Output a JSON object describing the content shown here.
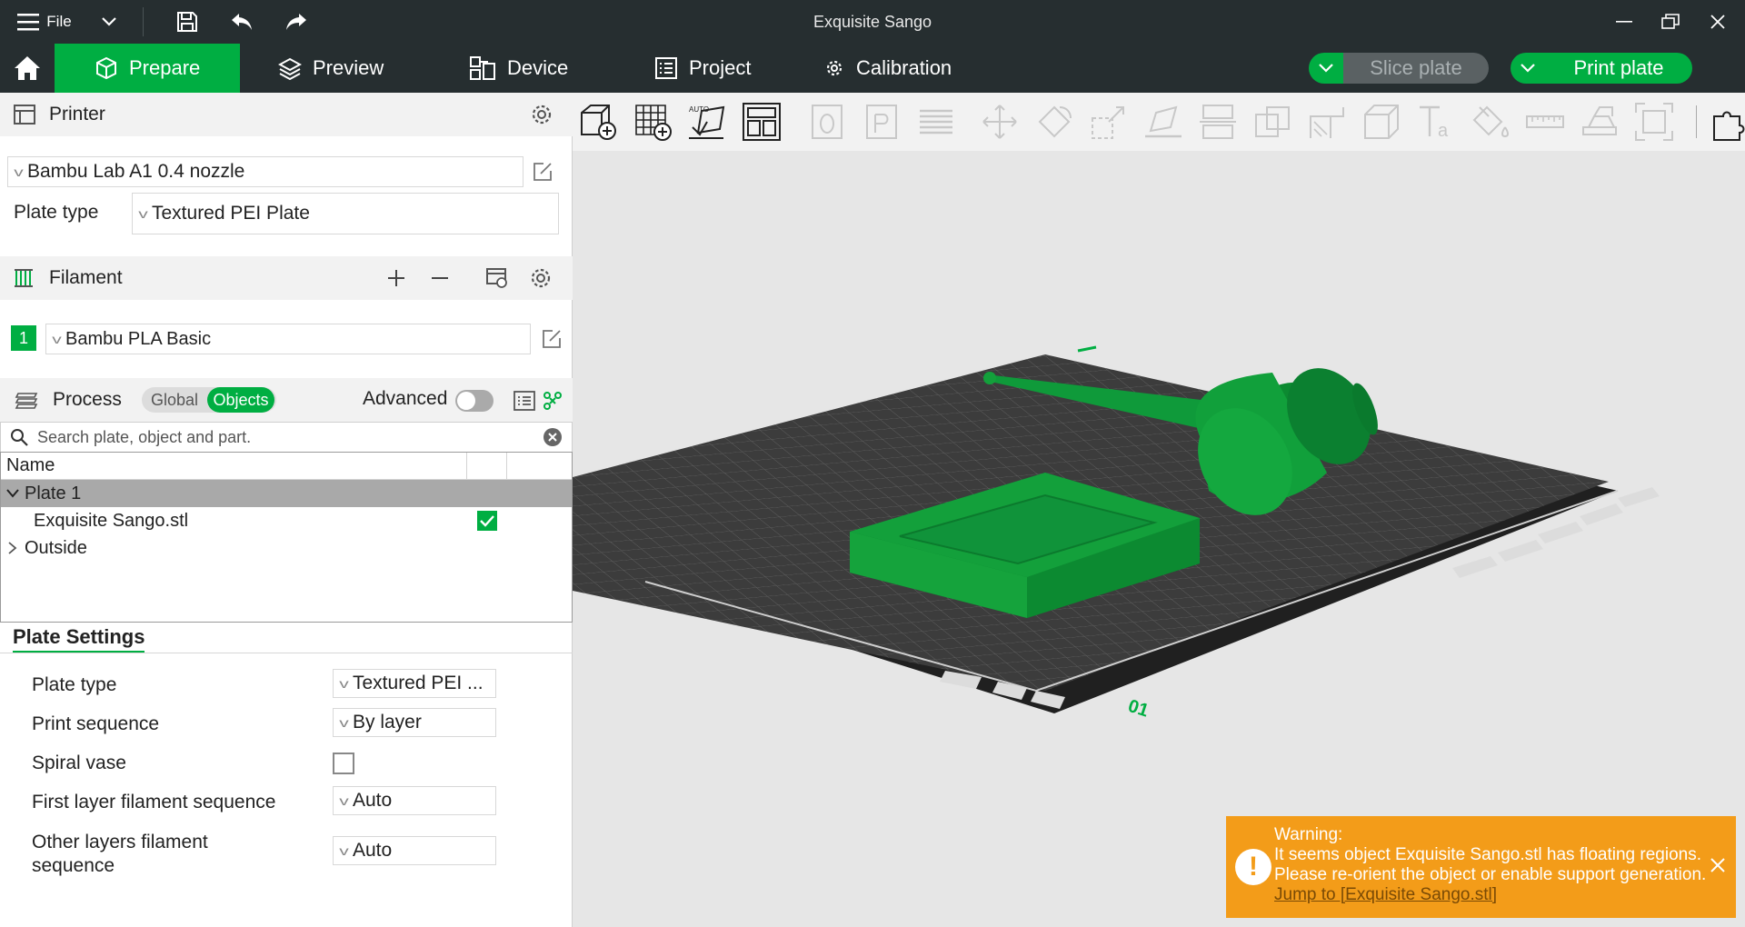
{
  "titlebar": {
    "menu_label": "File",
    "title": "Exquisite Sango"
  },
  "tabs": [
    {
      "label": "Prepare",
      "icon": "cube-icon",
      "active": true
    },
    {
      "label": "Preview",
      "icon": "layers-icon"
    },
    {
      "label": "Device",
      "icon": "device-icon"
    },
    {
      "label": "Project",
      "icon": "list-icon"
    },
    {
      "label": "Calibration",
      "icon": "gear-icon"
    }
  ],
  "actions": {
    "slice_label": "Slice plate",
    "print_label": "Print plate"
  },
  "printer": {
    "section_label": "Printer",
    "selected": "Bambu Lab A1 0.4 nozzle",
    "plate_type_label": "Plate type",
    "plate_type_value": "Textured PEI Plate"
  },
  "filament": {
    "section_label": "Filament",
    "slot_number": "1",
    "selected": "Bambu PLA Basic",
    "color": "#00ae42"
  },
  "process": {
    "section_label": "Process",
    "global_label": "Global",
    "objects_label": "Objects",
    "advanced_label": "Advanced"
  },
  "search": {
    "placeholder": "Search plate, object and part."
  },
  "tree": {
    "column_name": "Name",
    "plate_label": "Plate 1",
    "object_label": "Exquisite Sango.stl",
    "outside_label": "Outside"
  },
  "plate_settings": {
    "tab_label": "Plate Settings",
    "rows": [
      {
        "label": "Plate type",
        "value": "Textured PEI ..."
      },
      {
        "label": "Print sequence",
        "value": "By layer"
      },
      {
        "label": "Spiral vase",
        "value": ""
      },
      {
        "label": "First layer filament sequence",
        "value": "Auto"
      },
      {
        "label": "Other layers filament sequence",
        "value": "Auto"
      }
    ]
  },
  "viewport": {
    "plate_number": "01"
  },
  "warning": {
    "title": "Warning:",
    "message": "It seems object Exquisite Sango.stl has floating regions. Please re-orient the object or enable support generation.",
    "link": "Jump to [Exquisite Sango.stl]"
  },
  "colors": {
    "accent": "#00ae42",
    "titlebar": "#262e30",
    "warning": "#f39c19"
  }
}
